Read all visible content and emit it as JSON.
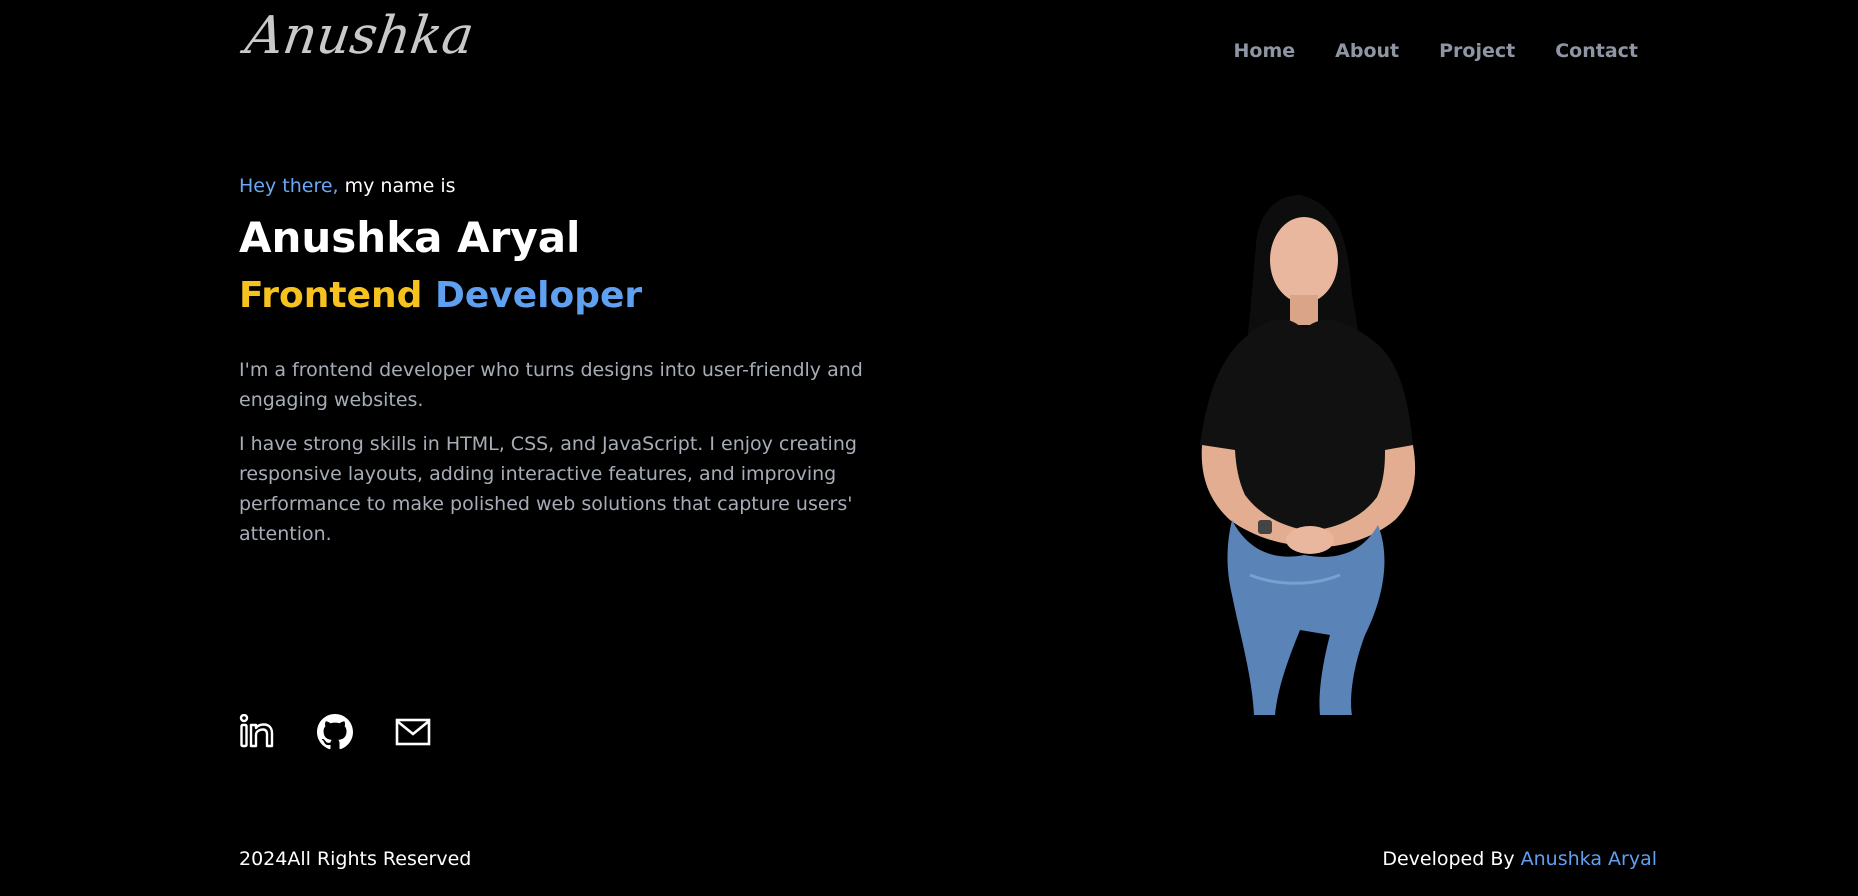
{
  "header": {
    "logo": "Anushka",
    "nav": [
      "Home",
      "About",
      "Project",
      "Contact"
    ]
  },
  "hero": {
    "greeting_accent": "Hey there,",
    "greeting_rest": " my name is",
    "name": "Anushka Aryal",
    "role_part1": "Frontend",
    "role_part2": "Developer",
    "paragraph1": "I'm a frontend developer who turns designs into user-friendly and engaging websites.",
    "paragraph2": "I have strong skills in HTML, CSS, and JavaScript. I enjoy creating responsive layouts, adding interactive features, and improving performance to make polished web solutions that capture users' attention."
  },
  "socials": [
    {
      "icon": "linkedin-icon"
    },
    {
      "icon": "github-icon"
    },
    {
      "icon": "mail-icon"
    }
  ],
  "footer": {
    "left": "2024All Rights Reserved",
    "right_prefix": "Developed By ",
    "right_link": "Anushka Aryal"
  },
  "colors": {
    "background": "#000000",
    "accent_blue": "#5fa0f0",
    "accent_yellow": "#f6c21e",
    "nav_gray": "#8f96a3"
  }
}
